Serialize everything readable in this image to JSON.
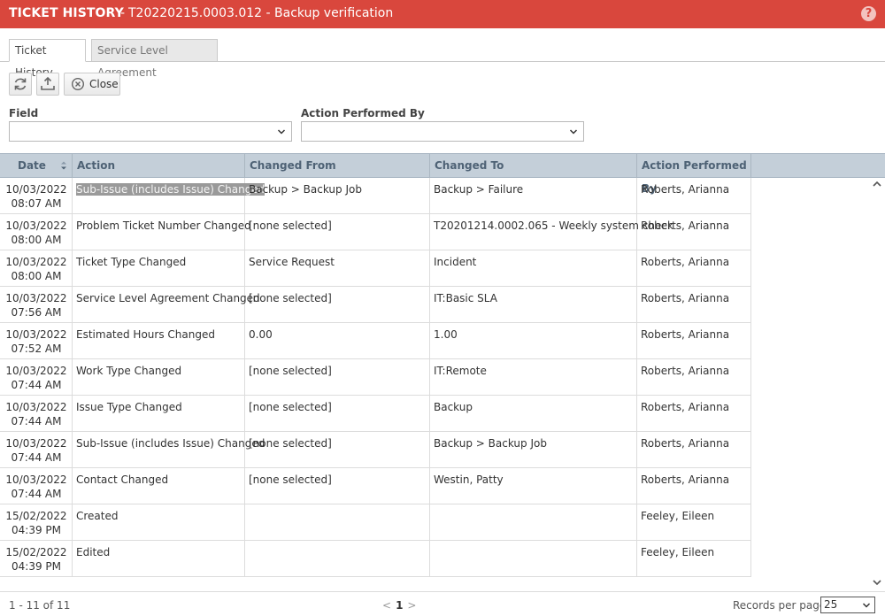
{
  "window": {
    "title": "TICKET HISTORY",
    "separator": "-",
    "subtitle": "T20220215.0003.012 - Backup verification",
    "help_icon": "?"
  },
  "tabs": [
    {
      "label": "Ticket History",
      "active": true
    },
    {
      "label": "Service Level Agreement",
      "active": false
    }
  ],
  "toolbar": {
    "close_label": "Close"
  },
  "filters": {
    "field_label": "Field",
    "field_value": "",
    "performed_by_label": "Action Performed By",
    "performed_by_value": ""
  },
  "grid": {
    "columns": [
      "Date",
      "Action",
      "Changed From",
      "Changed To",
      "Action Performed By"
    ],
    "rows": [
      {
        "date": "10/03/2022",
        "time": "08:07 AM",
        "action": "Sub-Issue (includes Issue) Changed",
        "from": "Backup > Backup Job",
        "to": "Backup > Failure",
        "by": "Roberts, Arianna"
      },
      {
        "date": "10/03/2022",
        "time": "08:00 AM",
        "action": "Problem Ticket Number Changed",
        "from": "[none selected]",
        "to": "T20201214.0002.065 - Weekly system check",
        "by": "Roberts, Arianna"
      },
      {
        "date": "10/03/2022",
        "time": "08:00 AM",
        "action": "Ticket Type Changed",
        "from": "Service Request",
        "to": "Incident",
        "by": "Roberts, Arianna"
      },
      {
        "date": "10/03/2022",
        "time": "07:56 AM",
        "action": "Service Level Agreement Changed",
        "from": "[none selected]",
        "to": "IT:Basic SLA",
        "by": "Roberts, Arianna"
      },
      {
        "date": "10/03/2022",
        "time": "07:52 AM",
        "action": "Estimated Hours Changed",
        "from": "0.00",
        "to": "1.00",
        "by": "Roberts, Arianna"
      },
      {
        "date": "10/03/2022",
        "time": "07:44 AM",
        "action": "Work Type Changed",
        "from": "[none selected]",
        "to": "IT:Remote",
        "by": "Roberts, Arianna"
      },
      {
        "date": "10/03/2022",
        "time": "07:44 AM",
        "action": "Issue Type Changed",
        "from": "[none selected]",
        "to": "Backup",
        "by": "Roberts, Arianna"
      },
      {
        "date": "10/03/2022",
        "time": "07:44 AM",
        "action": "Sub-Issue (includes Issue) Changed",
        "from": "[none selected]",
        "to": "Backup > Backup Job",
        "by": "Roberts, Arianna"
      },
      {
        "date": "10/03/2022",
        "time": "07:44 AM",
        "action": "Contact Changed",
        "from": "[none selected]",
        "to": "Westin, Patty",
        "by": "Roberts, Arianna"
      },
      {
        "date": "15/02/2022",
        "time": "04:39 PM",
        "action": "Created",
        "from": "",
        "to": "",
        "by": "Feeley, Eileen"
      },
      {
        "date": "15/02/2022",
        "time": "04:39 PM",
        "action": "Edited",
        "from": "",
        "to": "",
        "by": "Feeley, Eileen"
      }
    ]
  },
  "footer": {
    "count_text": "1 - 11 of 11",
    "prev": "<",
    "page": "1",
    "next": ">",
    "rpp_label": "Records per page:",
    "rpp_value": "25"
  },
  "colors": {
    "titlebar": "#d9473d",
    "grid_header": "#c4cfd9",
    "highlight": "#9a9a9a"
  }
}
